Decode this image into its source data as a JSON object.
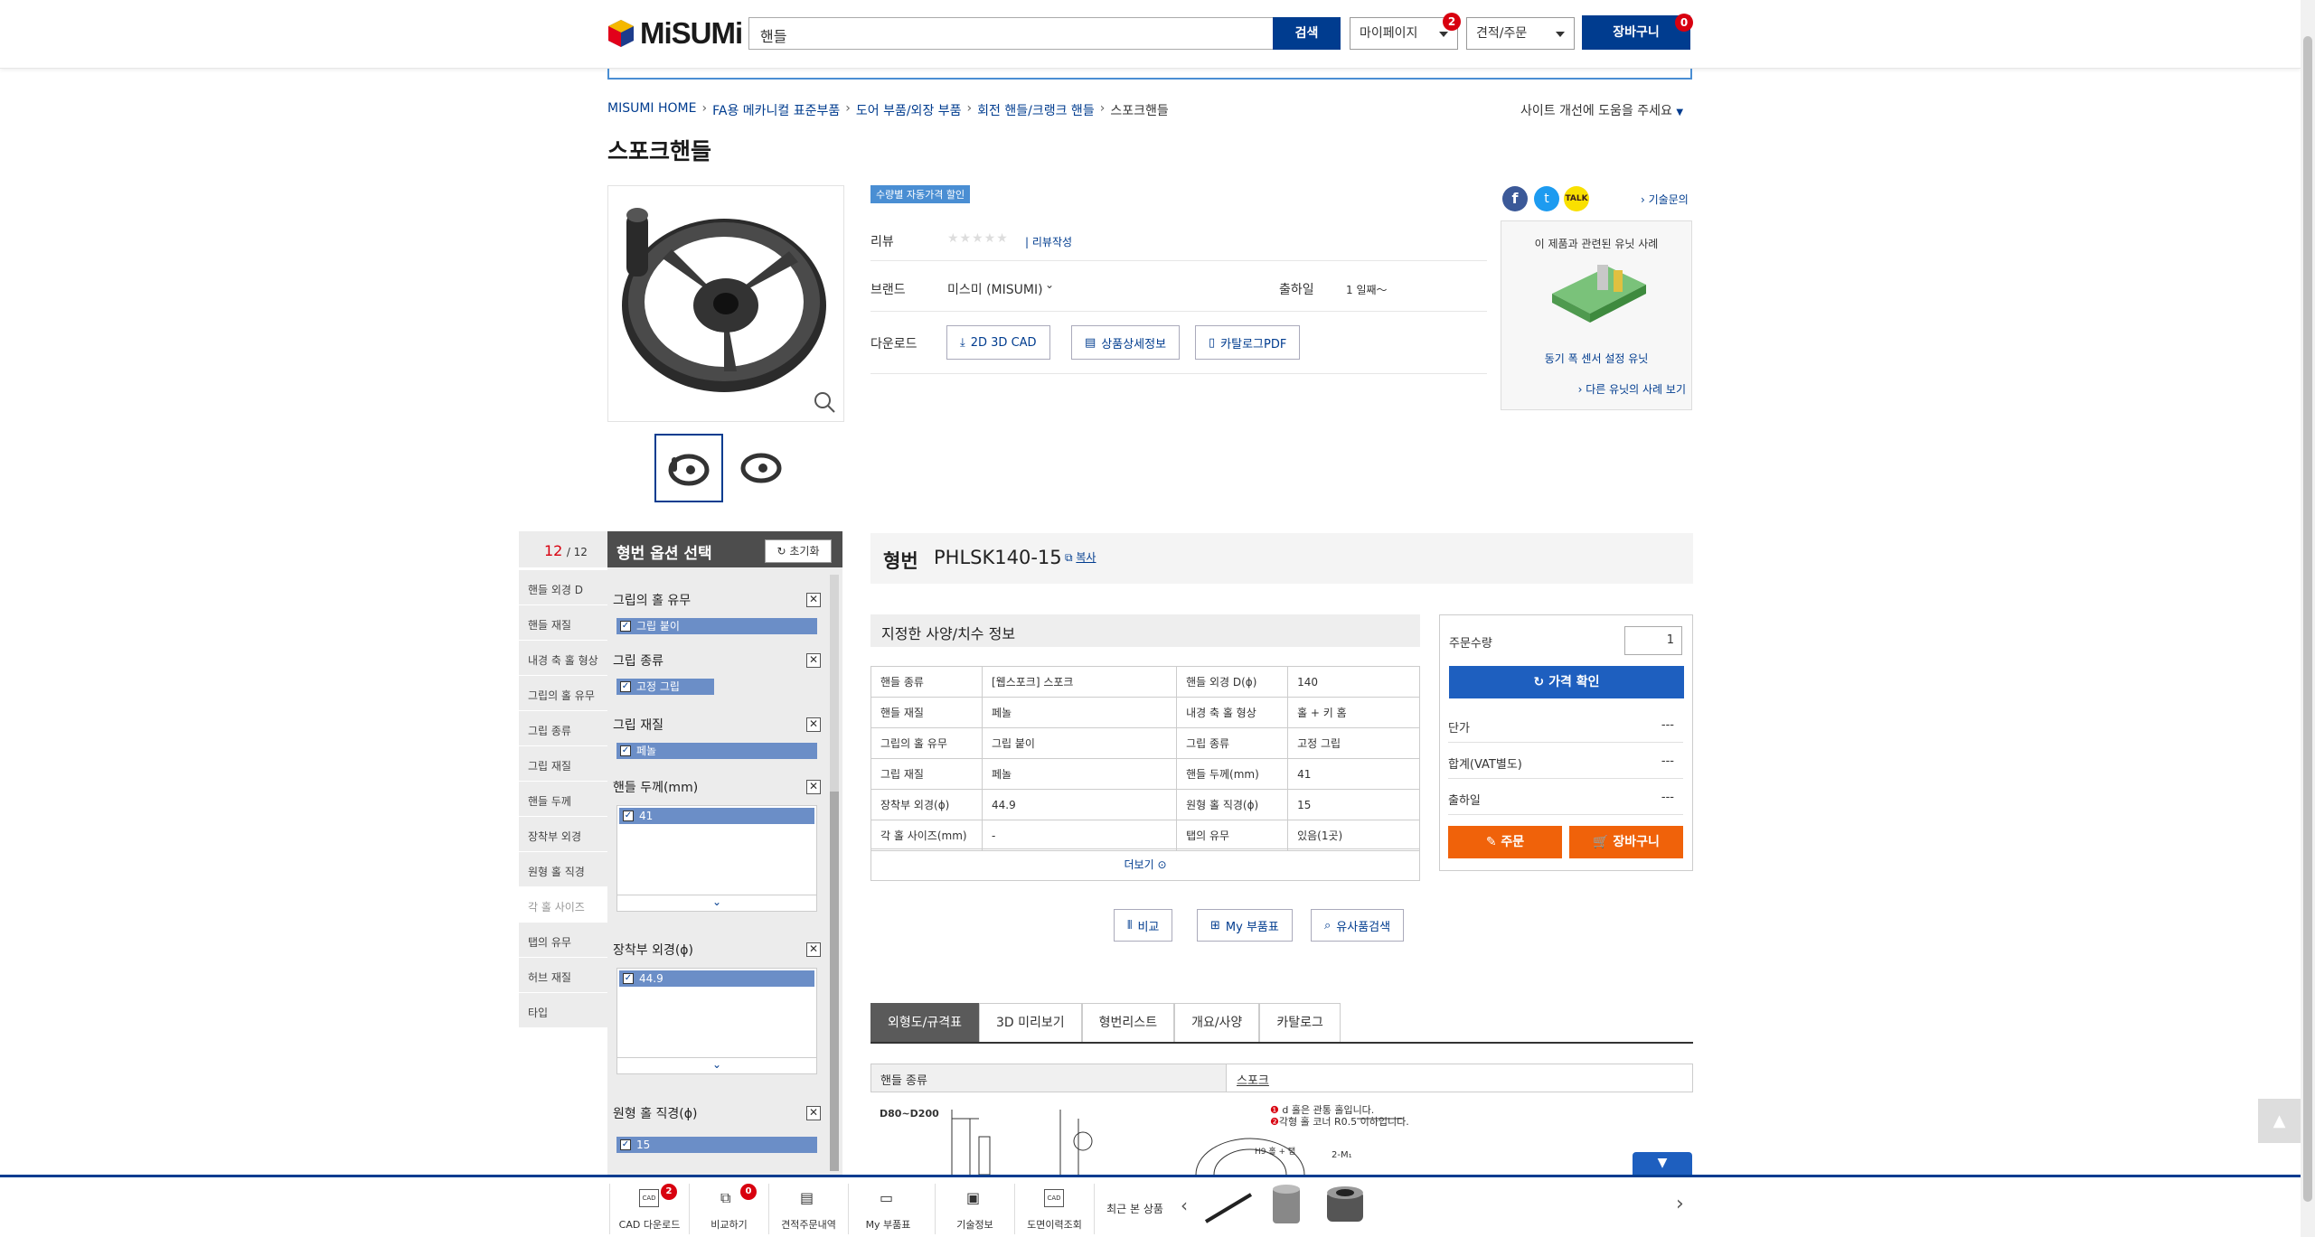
{
  "header": {
    "logo_text": "MiSUMi",
    "search_value": "핸들",
    "search_button": "검색",
    "mypage_label": "마이페이지",
    "mypage_badge": "2",
    "quote_label": "견적/주문",
    "cart_label": "장바구니",
    "cart_badge": "0"
  },
  "breadcrumb": {
    "items": [
      "MISUMI HOME",
      "FA용 메카니컬 표준부품",
      "도어 부품/외장 부품",
      "회전 핸들/크랭크 핸들",
      "스포크핸들"
    ],
    "help_text": "사이트 개선에 도움을 주세요"
  },
  "product": {
    "title": "스포크핸들",
    "tag": "수량별 자동가격 할인",
    "review_label": "리뷰",
    "review_write": "| 리뷰작성",
    "brand_label": "브랜드",
    "brand_value": "미스미 (MISUMI)",
    "ship_label": "출하일",
    "ship_value": "1 일째～",
    "download_label": "다운로드",
    "dl_cad": "2D 3D CAD",
    "dl_detail": "상품상세정보",
    "dl_catalog": "카탈로그PDF",
    "tech_inquiry": "기술문의",
    "case_title": "이 제품과 관련된 유닛 사례",
    "case_caption": "동기 폭 센서 설정 유닛",
    "case_more": "다른 유닛의 사례 보기",
    "colors": {
      "brand_blue": "#003c8f",
      "orange": "#f0620a",
      "badge_red": "#d8000f"
    }
  },
  "filter": {
    "count_current": "12",
    "count_total": "/ 12",
    "title": "형번 옵션 선택",
    "reset": "초기화",
    "side_items": [
      "핸들 외경 D",
      "핸들 재질",
      "내경 축 홀 형상",
      "그립의 홀 유무",
      "그립 종류",
      "그립 재질",
      "핸들 두께",
      "장착부 외경",
      "원형 홀 직경",
      "각 홀 사이즈",
      "탭의 유무",
      "허브 재질",
      "타입"
    ],
    "blocks": [
      {
        "title": "그립의 홀 유무",
        "chip": "그립 붙이"
      },
      {
        "title": "그립 종류",
        "chip": "고정 그립"
      },
      {
        "title": "그립 재질",
        "chip": "페놀"
      },
      {
        "title": "핸들 두께(mm)",
        "chip": "41"
      },
      {
        "title": "장착부 외경(ϕ)",
        "chip": "44.9"
      },
      {
        "title": "원형 홀 직경(ϕ)",
        "chip": "15"
      }
    ]
  },
  "part": {
    "label": "형번",
    "number": "PHLSK140-15",
    "copy": "복사",
    "spec_title": "지정한 사양/치수 정보",
    "spec_rows": [
      [
        "핸들 종류",
        "[웹스포크] 스포크",
        "핸들 외경 D(ϕ)",
        "140"
      ],
      [
        "핸들 재질",
        "페놀",
        "내경 축 홀 형상",
        "홀 + 키 홈"
      ],
      [
        "그립의 홀 유무",
        "그립 붙이",
        "그립 종류",
        "고정 그립"
      ],
      [
        "그립 재질",
        "페놀",
        "핸들 두께(mm)",
        "41"
      ],
      [
        "장착부 외경(ϕ)",
        "44.9",
        "원형 홀 직경(ϕ)",
        "15"
      ],
      [
        "각 홀 사이즈(mm)",
        "-",
        "탭의 유무",
        "있음(1곳)"
      ]
    ],
    "more": "더보기"
  },
  "order": {
    "qty_label": "주문수량",
    "qty_value": "1",
    "price_btn": "가격 확인",
    "unit_price": "단가",
    "total": "합계(VAT별도)",
    "ship": "출하일",
    "dash": "---",
    "order_btn": "주문",
    "cart_btn": "장바구니"
  },
  "actions": {
    "compare": "비교",
    "my_parts": "My 부품표",
    "similar": "유사품검색"
  },
  "tabs": [
    "외형도/규격표",
    "3D 미리보기",
    "형번리스트",
    "개요/사양",
    "카탈로그"
  ],
  "spec2": {
    "label": "핸들 종류",
    "value": "스포크"
  },
  "drawing": {
    "range": "D80~D200",
    "note1": "d 홀은 관통 홀입니다.",
    "note2": "각형 홀 코너 R0.5 이하입니다.",
    "h9": "H9 홀 + 탭",
    "m": "2-M₁"
  },
  "bottom_bar": {
    "items": [
      "CAD 다운로드",
      "비교하기",
      "견적주문내역",
      "My 부품표",
      "기술정보",
      "도면이력조회"
    ],
    "cad_badge": "2",
    "compare_badge": "0",
    "recent_label": "최근 본 상품"
  }
}
